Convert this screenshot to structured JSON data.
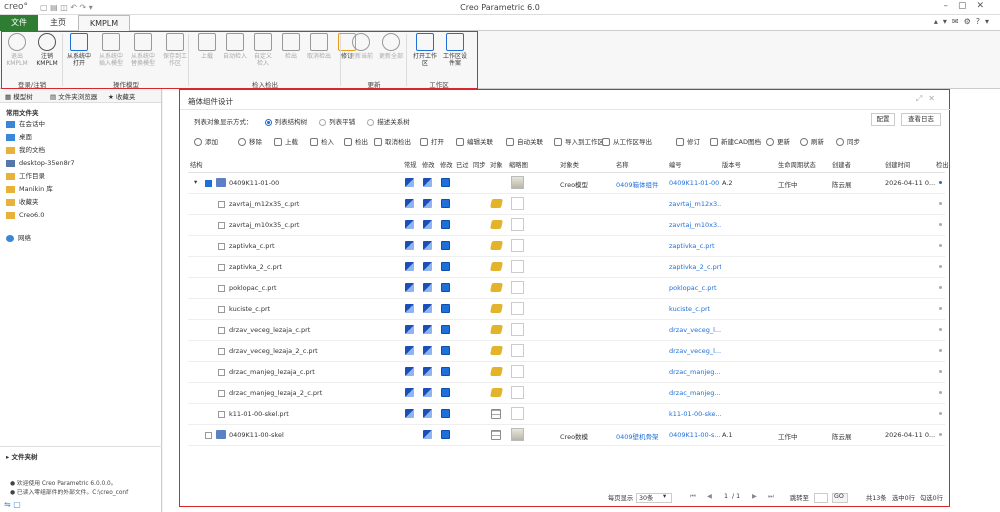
{
  "app": {
    "logo": "creo°",
    "title": "Creo Parametric 6.0"
  },
  "menu_tabs": {
    "file": "文件",
    "home": "主页",
    "kmplm": "KMPLM"
  },
  "ribbon": {
    "buttons": [
      {
        "label": "退出\nKMPLM",
        "icon": "exit-icon",
        "enabled": false
      },
      {
        "label": "注销\nKMPLM",
        "icon": "power-icon",
        "enabled": true
      },
      {
        "label": "从系统中\n打开",
        "icon": "open-from-system-icon",
        "enabled": true
      },
      {
        "label": "从系统中\n插入模型",
        "icon": "insert-model-icon",
        "enabled": false
      },
      {
        "label": "从系统中\n替换模型",
        "icon": "replace-model-icon",
        "enabled": false
      },
      {
        "label": "保存到工\n作区",
        "icon": "save-to-workspace-icon",
        "enabled": false
      },
      {
        "label": "上载",
        "icon": "upload-icon",
        "enabled": false
      },
      {
        "label": "自动检入",
        "icon": "auto-checkin-icon",
        "enabled": false
      },
      {
        "label": "自定义\n检入",
        "icon": "custom-checkin-icon",
        "enabled": false
      },
      {
        "label": "检出",
        "icon": "checkout-icon",
        "enabled": false
      },
      {
        "label": "取消检出",
        "icon": "undo-checkout-icon",
        "enabled": false
      },
      {
        "label": "修订",
        "icon": "revise-icon",
        "enabled": true
      },
      {
        "label": "更新当前",
        "icon": "update-current-icon",
        "enabled": false
      },
      {
        "label": "更新全部",
        "icon": "update-all-icon",
        "enabled": false
      },
      {
        "label": "打开工作\n区",
        "icon": "open-workspace-icon",
        "enabled": true
      },
      {
        "label": "工作区设\n件案",
        "icon": "workspace-settings-icon",
        "enabled": true
      }
    ],
    "groups": [
      "登录/注销",
      "操作模型",
      "检入检出",
      "更新",
      "工作区"
    ]
  },
  "left_panel": {
    "tabs": [
      "模型树",
      "文件夹浏览器",
      "收藏夹"
    ],
    "section": "常用文件夹",
    "items": [
      {
        "label": "在会话中",
        "icon": "session-icon"
      },
      {
        "label": "桌面",
        "icon": "desktop-icon"
      },
      {
        "label": "我的文档",
        "icon": "documents-icon"
      },
      {
        "label": "desktop-35en8r7",
        "icon": "computer-icon"
      },
      {
        "label": "工作目录",
        "icon": "folder-icon"
      },
      {
        "label": "Manikin 库",
        "icon": "folder-icon"
      },
      {
        "label": "收藏夹",
        "icon": "favorites-icon"
      },
      {
        "label": "Creo6.0",
        "icon": "folder-icon"
      }
    ],
    "network": "网络",
    "file_browser": "文件夹树",
    "messages": [
      "欢迎使用 Creo Parametric 6.0.0.0。",
      "已读入零组部件的外部文件。C:\\creo_conf"
    ]
  },
  "dialog": {
    "title": "箱体组件设计",
    "display_label": "列表对象显示方式：",
    "display_options": [
      "列表结构树",
      "列表平铺",
      "描述关系树"
    ],
    "config_btn": "配置",
    "log_btn": "查看日志",
    "toolbar": [
      "添加",
      "移除",
      "上载",
      "检入",
      "检出",
      "取消检出",
      "打开",
      "编辑关联",
      "自动关联",
      "导入到工作区",
      "从工作区导出",
      "修订",
      "新建CAD图档",
      "更新",
      "刷新",
      "同步"
    ],
    "columns": [
      "结构",
      "常规",
      "修改",
      "修改",
      "已过",
      "同步",
      "对象",
      "缩略图",
      "对象类",
      "名称",
      "编号",
      "版本号",
      "生命周期状态",
      "创建者",
      "创建时间",
      "检出"
    ],
    "rows": [
      {
        "level": 0,
        "name": "0409K11-01-00",
        "checked": true,
        "icons": [
          "bl",
          "bl",
          "bb"
        ],
        "obj": "",
        "thumb": "g",
        "class": "Creo模型",
        "cname": "0409箱体组件",
        "number": "0409K11-01-00",
        "ver": "A.2",
        "state": "工作中",
        "creator": "陈云展",
        "time": "2026-04-11 0...",
        "out": "bl"
      },
      {
        "level": 1,
        "name": "zavrtaj_m12x35_c.prt",
        "checked": false,
        "icons": [
          "bl",
          "bl",
          "bb"
        ],
        "obj": "pt",
        "thumb": "",
        "class": "",
        "cname": "",
        "number": "zavrtaj_m12x3...",
        "ver": "",
        "state": "",
        "creator": "",
        "time": "",
        "out": ""
      },
      {
        "level": 1,
        "name": "zavrtaj_m10x35_c.prt",
        "checked": false,
        "icons": [
          "bl",
          "bl",
          "bb"
        ],
        "obj": "pt",
        "thumb": "",
        "class": "",
        "cname": "",
        "number": "zavrtaj_m10x3...",
        "ver": "",
        "state": "",
        "creator": "",
        "time": "",
        "out": ""
      },
      {
        "level": 1,
        "name": "zaptivka_c.prt",
        "checked": false,
        "icons": [
          "bl",
          "bl",
          "bb"
        ],
        "obj": "pt",
        "thumb": "",
        "class": "",
        "cname": "",
        "number": "zaptivka_c.prt",
        "ver": "",
        "state": "",
        "creator": "",
        "time": "",
        "out": ""
      },
      {
        "level": 1,
        "name": "zaptivka_2_c.prt",
        "checked": false,
        "icons": [
          "bl",
          "bl",
          "bb"
        ],
        "obj": "pt",
        "thumb": "",
        "class": "",
        "cname": "",
        "number": "zaptivka_2_c.prt",
        "ver": "",
        "state": "",
        "creator": "",
        "time": "",
        "out": ""
      },
      {
        "level": 1,
        "name": "poklopac_c.prt",
        "checked": false,
        "icons": [
          "bl",
          "bl",
          "bb"
        ],
        "obj": "pt",
        "thumb": "",
        "class": "",
        "cname": "",
        "number": "poklopac_c.prt",
        "ver": "",
        "state": "",
        "creator": "",
        "time": "",
        "out": ""
      },
      {
        "level": 1,
        "name": "kuciste_c.prt",
        "checked": false,
        "icons": [
          "bl",
          "bl",
          "bb"
        ],
        "obj": "pt",
        "thumb": "",
        "class": "",
        "cname": "",
        "number": "kuciste_c.prt",
        "ver": "",
        "state": "",
        "creator": "",
        "time": "",
        "out": ""
      },
      {
        "level": 1,
        "name": "drzav_veceg_lezaja_c.prt",
        "checked": false,
        "icons": [
          "bl",
          "bl",
          "bb"
        ],
        "obj": "pt",
        "thumb": "",
        "class": "",
        "cname": "",
        "number": "drzav_veceg_l...",
        "ver": "",
        "state": "",
        "creator": "",
        "time": "",
        "out": ""
      },
      {
        "level": 1,
        "name": "drzav_veceg_lezaja_2_c.prt",
        "checked": false,
        "icons": [
          "bl",
          "bl",
          "bb"
        ],
        "obj": "pt",
        "thumb": "",
        "class": "",
        "cname": "",
        "number": "drzav_veceg_l...",
        "ver": "",
        "state": "",
        "creator": "",
        "time": "",
        "out": ""
      },
      {
        "level": 1,
        "name": "drzac_manjeg_lezaja_c.prt",
        "checked": false,
        "icons": [
          "bl",
          "bl",
          "bb"
        ],
        "obj": "pt",
        "thumb": "",
        "class": "",
        "cname": "",
        "number": "drzac_manjeg...",
        "ver": "",
        "state": "",
        "creator": "",
        "time": "",
        "out": ""
      },
      {
        "level": 1,
        "name": "drzac_manjeg_lezaja_2_c.prt",
        "checked": false,
        "icons": [
          "bl",
          "bl",
          "bb"
        ],
        "obj": "pt",
        "thumb": "",
        "class": "",
        "cname": "",
        "number": "drzac_manjeg...",
        "ver": "",
        "state": "",
        "creator": "",
        "time": "",
        "out": ""
      },
      {
        "level": 1,
        "name": "k11-01-00-skel.prt",
        "checked": false,
        "icons": [
          "bl",
          "bl",
          "bb"
        ],
        "obj": "sk",
        "thumb": "",
        "class": "",
        "cname": "",
        "number": "k11-01-00-ske...",
        "ver": "",
        "state": "",
        "creator": "",
        "time": "",
        "out": ""
      },
      {
        "level": 0,
        "name": "0409K11-00-skel",
        "checked": false,
        "icons": [
          "",
          "bl",
          "bb"
        ],
        "obj": "sk",
        "thumb": "g",
        "class": "Creo数模",
        "cname": "0409壁机骨架",
        "number": "0409K11-00-s...",
        "ver": "A.1",
        "state": "工作中",
        "creator": "陈云展",
        "time": "2026-04-11 0...",
        "out": ""
      }
    ],
    "pager": {
      "per_page_label": "每页显示",
      "per_page": "30条",
      "page": "1",
      "total_pages": "/ 1",
      "jump_label": "跳转至",
      "go": "GO",
      "total": "共13条",
      "selected": "选中0行",
      "checked": "勾选0行"
    }
  },
  "colors": {
    "accent": "#1e6fd9",
    "file_tab": "#2e7d32",
    "highlight_frame": "#d9252c"
  }
}
